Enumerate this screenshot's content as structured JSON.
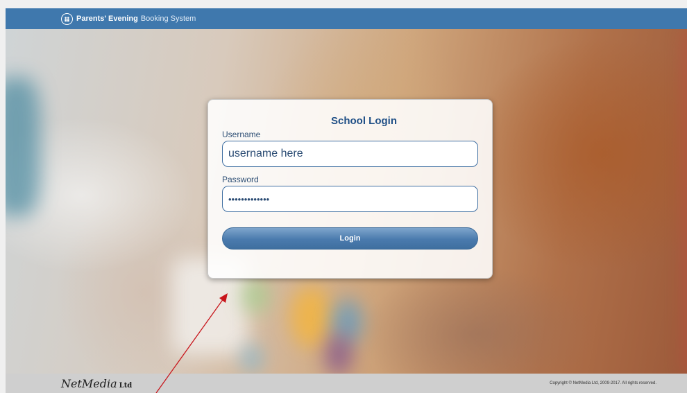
{
  "header": {
    "brand_strong": "Parents' Evening",
    "brand_light": "Booking System"
  },
  "login": {
    "title": "School Login",
    "username_label": "Username",
    "username_value": "username here",
    "password_label": "Password",
    "password_value": "•••••••••••••",
    "button_label": "Login"
  },
  "footer": {
    "brand": "NetMedia",
    "brand_suffix": "Ltd",
    "copyright": "Copyright © NetMedia Ltd, 2009-2017. All rights reserved."
  },
  "icons": {
    "header_logo": "school-badge-icon",
    "annotation": "red-arrow-annotation"
  },
  "colors": {
    "header_bg": "#3f78ad",
    "title_text": "#1f4f86",
    "button": "#4a7aad",
    "annotation_arrow": "#c8151b"
  }
}
